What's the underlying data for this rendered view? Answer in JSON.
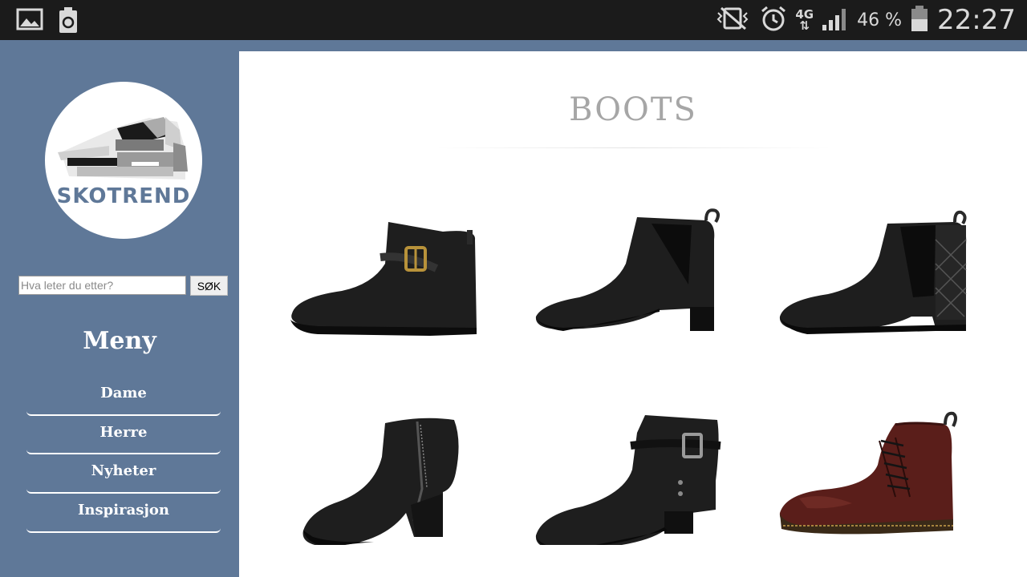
{
  "status_bar": {
    "left_icons": [
      "gallery-icon",
      "battery-saver-icon"
    ],
    "right_icons": [
      "vibrate-icon",
      "alarm-clock-icon",
      "network-4g-icon",
      "signal-icon",
      "battery-icon"
    ],
    "network": "4G",
    "battery_percent": "46 %",
    "time": "22:27"
  },
  "sidebar": {
    "logo_text": "SKOTREND",
    "search": {
      "placeholder": "Hva leter du etter?",
      "button_label": "SØK"
    },
    "menu_title": "Meny",
    "menu_items": [
      {
        "label": "Dame"
      },
      {
        "label": "Herre"
      },
      {
        "label": "Nyheter"
      },
      {
        "label": "Inspirasjon"
      }
    ]
  },
  "main": {
    "title": "BOOTS",
    "products": [
      {
        "name": "black-buckle-ankle-boot",
        "color": "#1e1e1e"
      },
      {
        "name": "black-chelsea-boot",
        "color": "#1e1e1e"
      },
      {
        "name": "black-quilted-chelsea-boot",
        "color": "#1e1e1e"
      },
      {
        "name": "black-zip-ankle-boot",
        "color": "#1e1e1e"
      },
      {
        "name": "black-strap-ankle-boot",
        "color": "#1e1e1e"
      },
      {
        "name": "burgundy-brogue-lace-boot",
        "color": "#5a1e1a"
      }
    ]
  },
  "colors": {
    "sidebar_bg": "#5f7898",
    "status_bar_bg": "#1b1b1b",
    "title_gray": "#a6a6a6"
  }
}
